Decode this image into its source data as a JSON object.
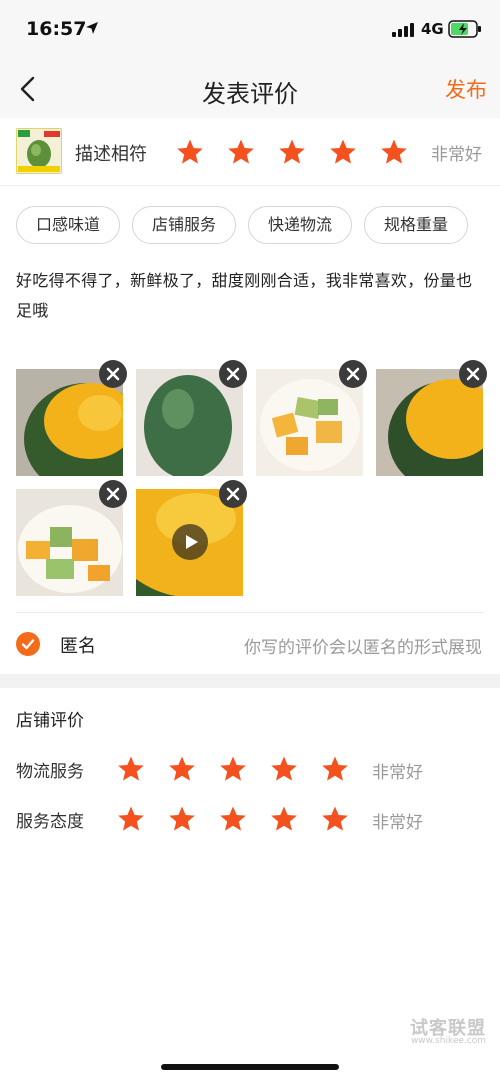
{
  "status_bar": {
    "time": "16:57",
    "network": "4G",
    "icons": [
      "location-arrow-icon",
      "signal-icon",
      "battery-charging-icon"
    ]
  },
  "nav": {
    "title": "发表评价",
    "publish_label": "发布",
    "back_icon": "chevron-left-icon",
    "accent_color": "#f46b1a"
  },
  "product": {
    "thumb_text_top": "新品",
    "thumb_text_sub": "海南大芒",
    "thumb_price": "36.8",
    "rating_label": "描述相符",
    "stars": 5,
    "rating_text": "非常好"
  },
  "tags": [
    "口感味道",
    "店铺服务",
    "快递物流",
    "规格重量"
  ],
  "review": {
    "text": "好吃得不得了，新鲜极了，甜度刚刚合适，我非常喜欢，份量也足哦"
  },
  "photos": {
    "count": 6,
    "remove_icon": "close-icon",
    "video_icon": "play-icon"
  },
  "anonymous": {
    "label": "匿名",
    "checked": true,
    "hint": "你写的评价会以匿名的形式展现"
  },
  "shop_rating": {
    "title": "店铺评价",
    "rows": [
      {
        "label": "物流服务",
        "stars": 5,
        "text": "非常好"
      },
      {
        "label": "服务态度",
        "stars": 5,
        "text": "非常好"
      }
    ]
  },
  "watermark": {
    "text": "试客联盟",
    "url": "www.shikee.com"
  },
  "colors": {
    "accent": "#f46b1a",
    "star": "#f4511e",
    "muted": "#9a9a9a"
  }
}
